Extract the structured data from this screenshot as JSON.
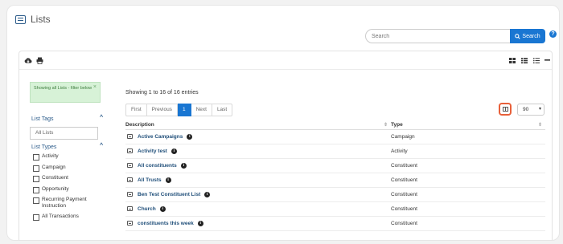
{
  "header": {
    "title": "Lists"
  },
  "search": {
    "placeholder": "Search",
    "button_label": "Search"
  },
  "sidebar": {
    "filter_note": "Showing all Lists - filter below",
    "list_tags_label": "List Tags",
    "list_tags_placeholder": "All Lists",
    "list_types_label": "List Types",
    "types": [
      "Activity",
      "Campaign",
      "Constituent",
      "Opportunity",
      "Recurring Payment Instruction",
      "All Transactions"
    ]
  },
  "table_info": {
    "showing": "Showing 1 to 16 of 16 entries"
  },
  "pager": {
    "first": "First",
    "previous": "Previous",
    "current": "1",
    "next": "Next",
    "last": "Last"
  },
  "page_size": {
    "value": "90"
  },
  "table": {
    "columns": [
      "Description",
      "Type"
    ],
    "rows": [
      {
        "name": "Active Campaigns",
        "type": "Campaign"
      },
      {
        "name": "Activity test",
        "type": "Activity"
      },
      {
        "name": "All constituents",
        "type": "Constituent"
      },
      {
        "name": "All Trusts",
        "type": "Constituent"
      },
      {
        "name": "Ben Test Constituent List",
        "type": "Constituent"
      },
      {
        "name": "Church",
        "type": "Constituent"
      },
      {
        "name": "constituents this week",
        "type": "Constituent"
      }
    ]
  },
  "colors": {
    "accent": "#1976d2",
    "highlight": "#e8603a",
    "link": "#1f4e79"
  }
}
